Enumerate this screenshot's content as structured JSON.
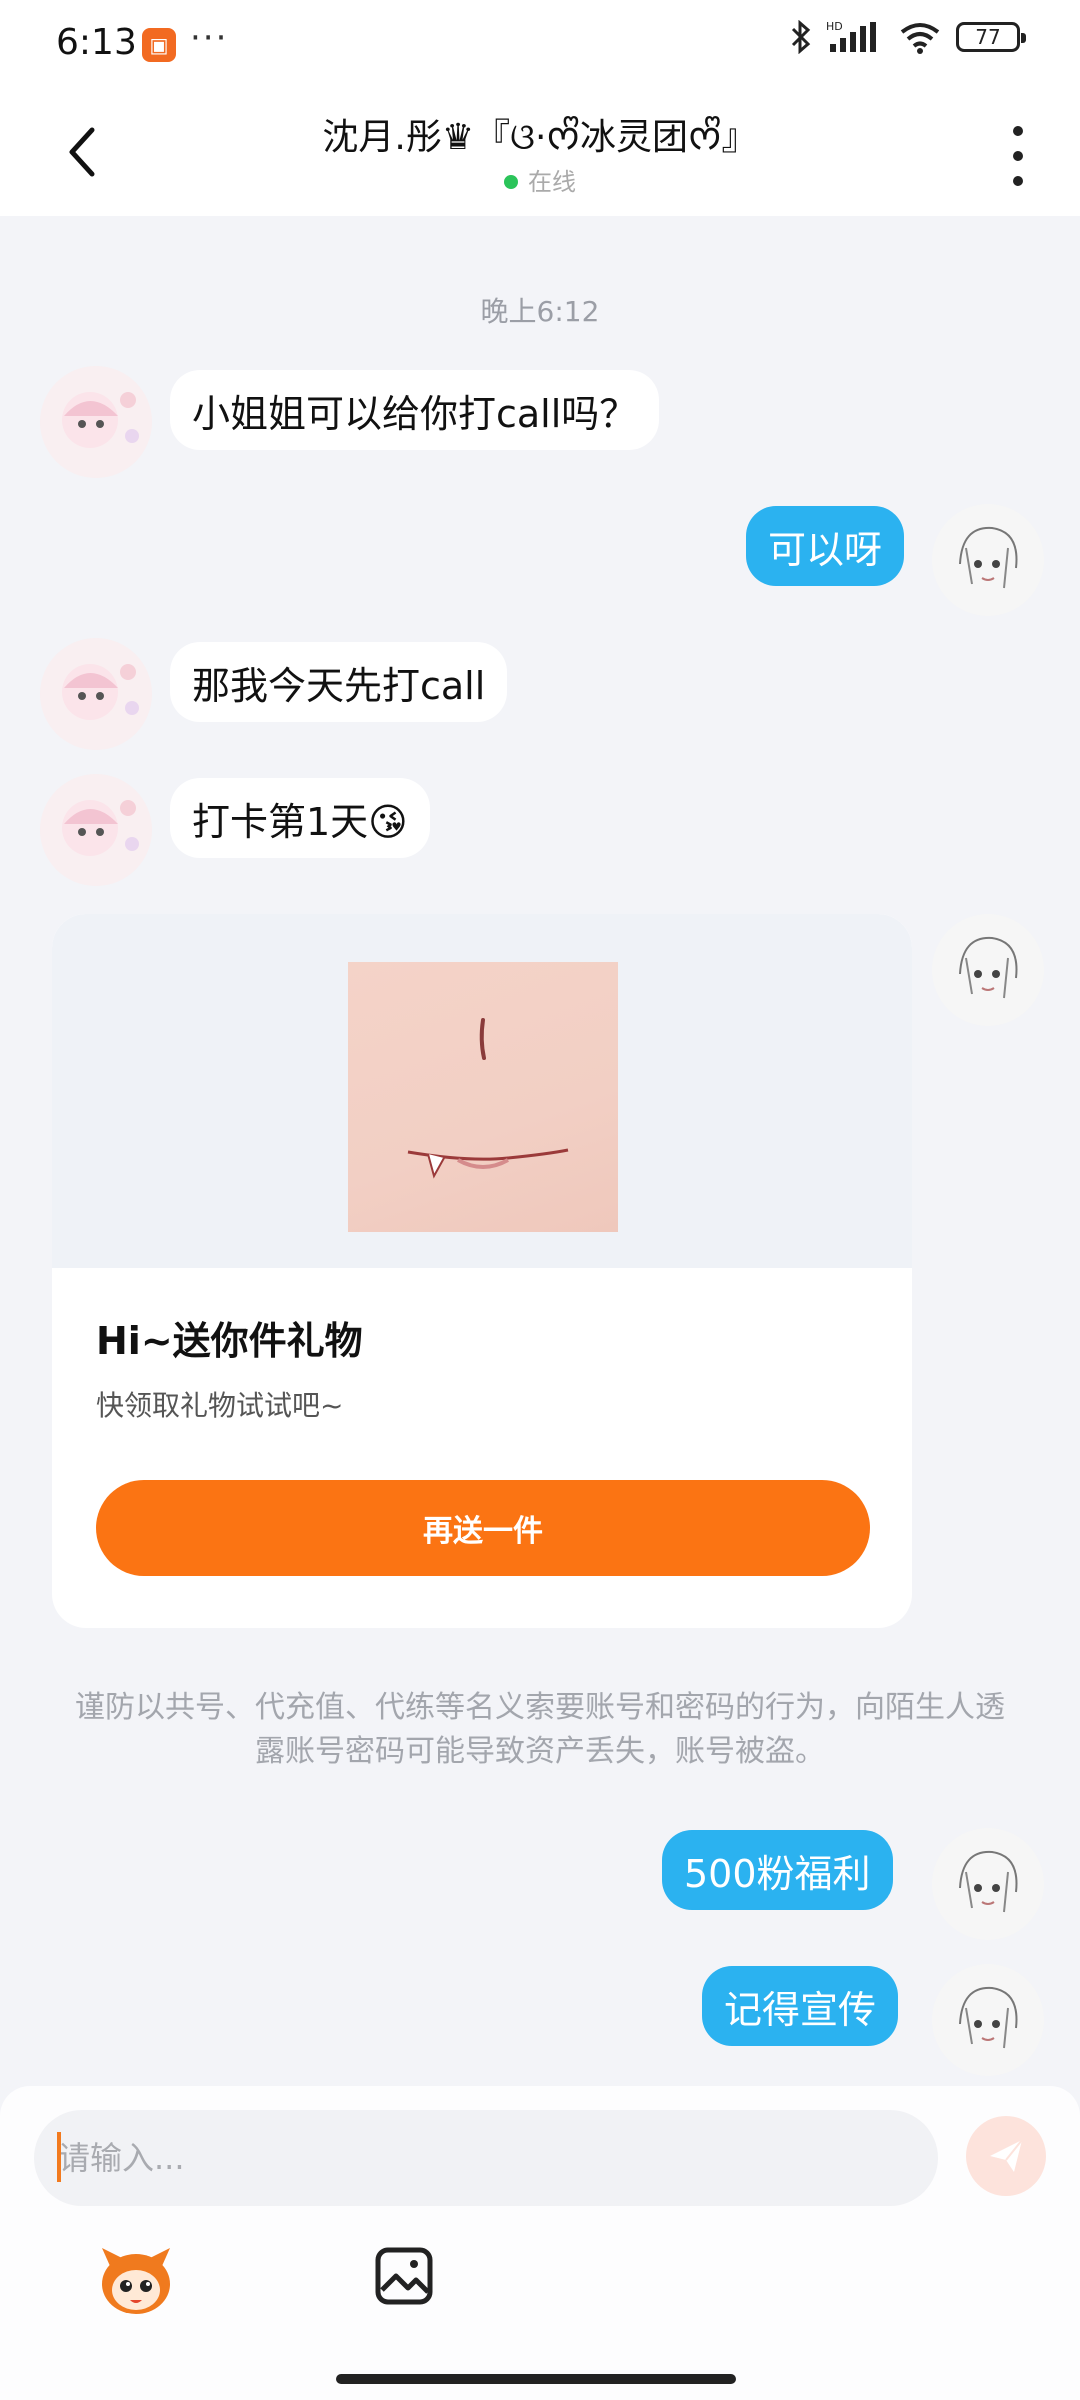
{
  "status_bar": {
    "time": "6:13",
    "dots": "···",
    "battery": "77"
  },
  "header": {
    "title": "沈月.彤♛『ଓ·ᰔᩚ冰灵团ᰔᩚ』",
    "status": "在线"
  },
  "messages": {
    "timestamp": "晚上6:12",
    "m1": "小姐姐可以给你打call吗？",
    "m2": "可以呀",
    "m3": "那我今天先打call",
    "m4": "打卡第1天😘",
    "gift": {
      "title": "Hi~送你件礼物",
      "subtitle": "快领取礼物试试吧~",
      "button": "再送一件"
    },
    "warning": "谨防以共号、代充值、代练等名义索要账号和密码的行为，向陌生人透露账号密码可能导致资产丢失，账号被盗。",
    "m5": "500粉福利",
    "m6": "记得宣传"
  },
  "input": {
    "placeholder": "请输入..."
  },
  "colors": {
    "outgoing_bubble": "#2bb2f0",
    "gift_button": "#fb7413",
    "online_dot": "#2bc45a",
    "background": "#f3f4f8"
  },
  "icons": [
    "back-icon",
    "more-icon",
    "bluetooth-icon",
    "signal-icon",
    "wifi-icon",
    "battery-icon",
    "send-icon",
    "mascot-icon",
    "image-icon"
  ]
}
